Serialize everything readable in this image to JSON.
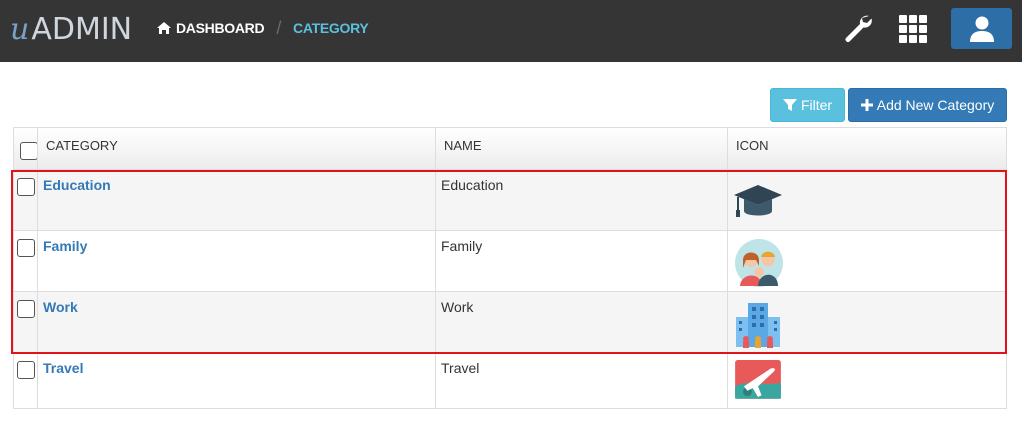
{
  "app": {
    "logo_u": "u",
    "logo_text": "ADMIN"
  },
  "breadcrumb": {
    "home": "DASHBOARD",
    "separator": "/",
    "current": "CATEGORY"
  },
  "header_icons": [
    "wrench-icon",
    "apps-grid-icon",
    "user-icon"
  ],
  "toolbar": {
    "filter_label": "Filter",
    "add_label": "Add New Category"
  },
  "table": {
    "columns": [
      "CATEGORY",
      "NAME",
      "ICON"
    ],
    "rows": [
      {
        "category": "Education",
        "name": "Education",
        "icon": "graduation-cap-icon"
      },
      {
        "category": "Family",
        "name": "Family",
        "icon": "family-icon"
      },
      {
        "category": "Work",
        "name": "Work",
        "icon": "office-building-icon"
      },
      {
        "category": "Travel",
        "name": "Travel",
        "icon": "airplane-icon"
      }
    ]
  },
  "colors": {
    "topbar": "#353535",
    "accent_info": "#5bc0de",
    "accent_primary": "#337ab7",
    "highlight": "#e0121a"
  }
}
